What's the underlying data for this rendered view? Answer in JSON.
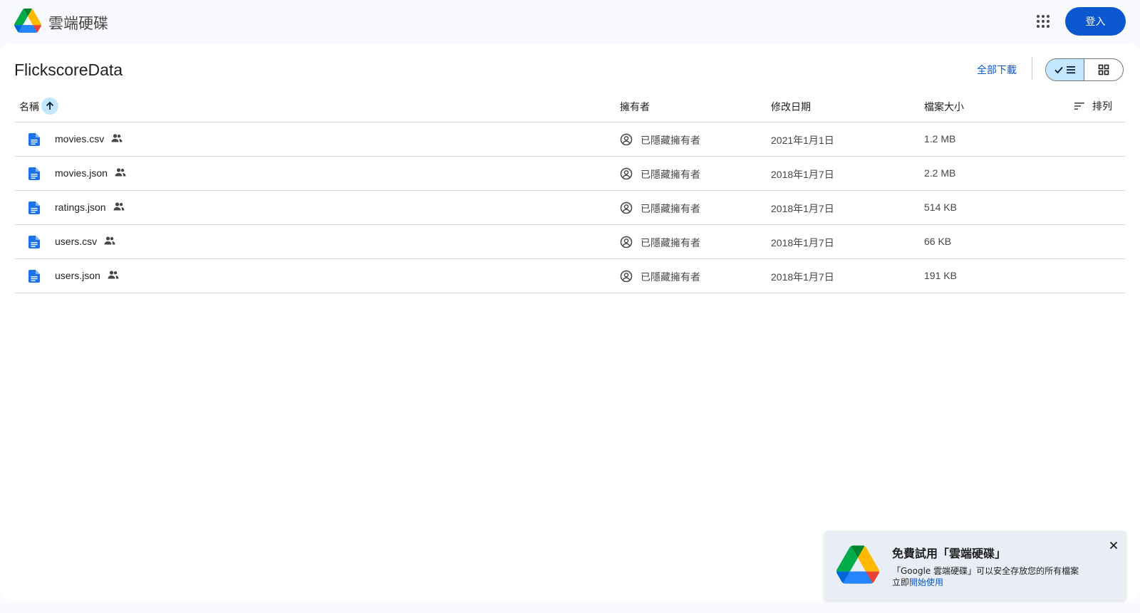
{
  "header": {
    "app_name": "雲端硬碟",
    "signin_label": "登入"
  },
  "folder": {
    "title": "FlickscoreData",
    "download_all_label": "全部下載",
    "view_modes": [
      "list",
      "grid"
    ],
    "active_view": "list"
  },
  "columns": {
    "name": "名稱",
    "owner": "擁有者",
    "modified": "修改日期",
    "size": "檔案大小",
    "sort_label": "排列"
  },
  "files": [
    {
      "name": "movies.csv",
      "owner": "已隱藏擁有者",
      "modified": "2021年1月1日",
      "size": "1.2 MB"
    },
    {
      "name": "movies.json",
      "owner": "已隱藏擁有者",
      "modified": "2018年1月7日",
      "size": "2.2 MB"
    },
    {
      "name": "ratings.json",
      "owner": "已隱藏擁有者",
      "modified": "2018年1月7日",
      "size": "514 KB"
    },
    {
      "name": "users.csv",
      "owner": "已隱藏擁有者",
      "modified": "2018年1月7日",
      "size": "66 KB"
    },
    {
      "name": "users.json",
      "owner": "已隱藏擁有者",
      "modified": "2018年1月7日",
      "size": "191 KB"
    }
  ],
  "promo": {
    "title": "免費試用「雲端硬碟」",
    "description": "「Google 雲端硬碟」可以安全存放您的所有檔案",
    "cta_prefix": "立即",
    "cta_link": "開始使用"
  },
  "icons": {
    "file": "doc-file-icon",
    "shared": "shared-people-icon",
    "owner": "account-circle-icon"
  },
  "colors": {
    "primary": "#0b57d0",
    "selected": "#c2e7ff",
    "background": "#f8fafd",
    "file_icon": "#1a73e8"
  }
}
